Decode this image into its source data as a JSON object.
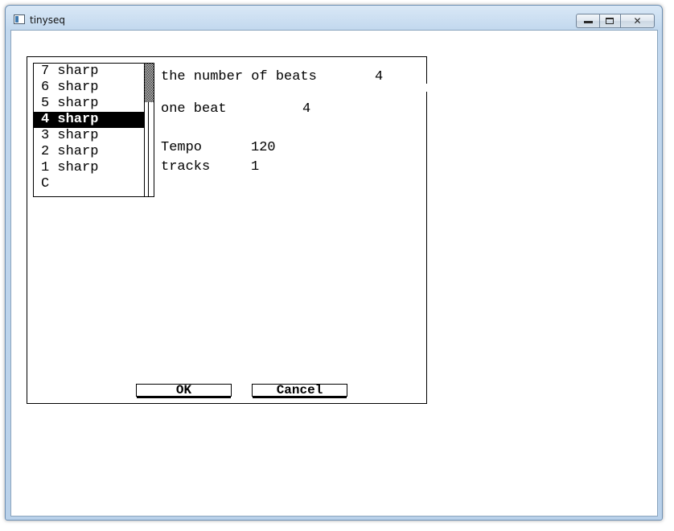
{
  "window": {
    "title": "tinyseq",
    "icon": "app-window-icon",
    "minimize_icon": "minimize-icon",
    "maximize_icon": "maximize-icon",
    "close_glyph": "✕"
  },
  "dialog": {
    "key_list": {
      "items": [
        "7 sharp",
        "6 sharp",
        "5 sharp",
        "4 sharp",
        "3 sharp",
        "2 sharp",
        "1 sharp",
        "C"
      ],
      "selected_index": 3,
      "selected_label": "4 sharp"
    },
    "beats_label": "the number of beats",
    "beats_value": "4",
    "one_beat_label": "one beat",
    "one_beat_value": "4",
    "tempo_label": "Tempo",
    "tempo_value": "120",
    "tracks_label": "tracks",
    "tracks_value": "1",
    "ok_label": "OK",
    "cancel_label": "Cancel"
  }
}
